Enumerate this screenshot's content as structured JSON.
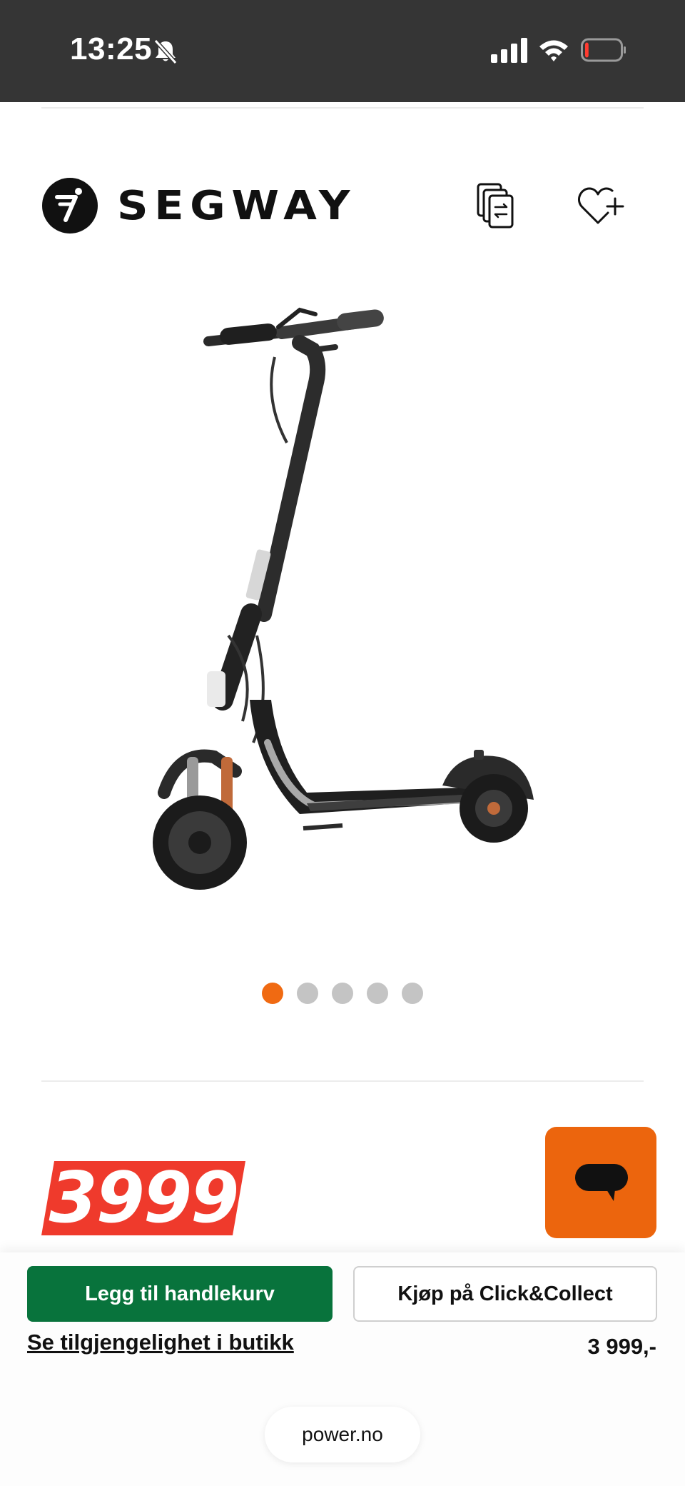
{
  "status_bar": {
    "time": "13:25",
    "icons": [
      "bell-slash-icon",
      "cellular-signal-icon",
      "wifi-icon",
      "battery-low-icon"
    ],
    "battery_level": 0.1
  },
  "brand": {
    "name": "SEGWAY"
  },
  "header_actions": {
    "compare_icon": "compare-icon",
    "wishlist_icon": "heart-plus-icon"
  },
  "carousel": {
    "total": 5,
    "active_index": 0
  },
  "price": {
    "badge": "3999",
    "amount": "3 999,-"
  },
  "actions": {
    "add_to_cart": "Legg til handlekurv",
    "click_collect": "Kjøp på Click&Collect",
    "availability": "Se tilgjengelighet i butikk"
  },
  "browser": {
    "url": "power.no"
  },
  "colors": {
    "accent_orange": "#ec650d",
    "cart_green": "#08733c",
    "price_red": "#ef3a2c",
    "status_bar_bg": "#353535"
  }
}
